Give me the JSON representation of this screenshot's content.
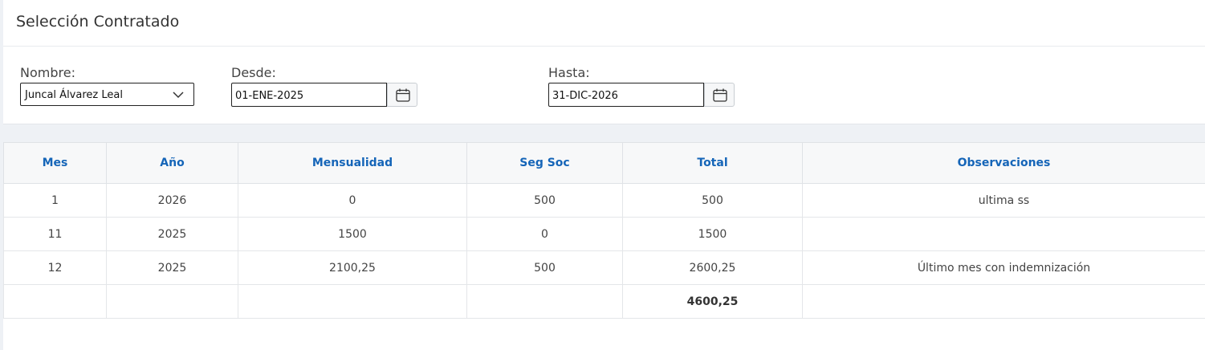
{
  "panel": {
    "title": "Selección Contratado",
    "nombre_label": "Nombre:",
    "nombre_value": "Juncal Álvarez Leal",
    "desde_label": "Desde:",
    "desde_value": "01-ENE-2025",
    "hasta_label": "Hasta:",
    "hasta_value": "31-DIC-2026"
  },
  "table": {
    "headers": [
      "Mes",
      "Año",
      "Mensualidad",
      "Seg Soc",
      "Total",
      "Observaciones"
    ],
    "rows": [
      [
        "1",
        "2026",
        "0",
        "500",
        "500",
        "ultima ss"
      ],
      [
        "11",
        "2025",
        "1500",
        "0",
        "1500",
        ""
      ],
      [
        "12",
        "2025",
        "2100,25",
        "500",
        "2600,25",
        "Último mes con indemnización"
      ]
    ],
    "total": "4600,25"
  },
  "colors": {
    "header_text": "#1565b8",
    "background": "#eef1f5"
  }
}
